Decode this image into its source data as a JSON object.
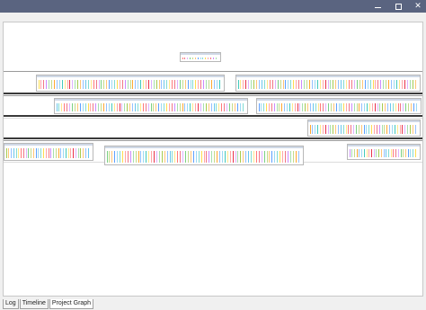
{
  "window": {
    "controls": {
      "minimize_icon": "minimize-icon",
      "maximize_icon": "maximize-icon",
      "close_icon": "close-icon"
    }
  },
  "tabs": [
    {
      "label": "Log",
      "active": false
    },
    {
      "label": "Timeline",
      "active": false
    },
    {
      "label": "Project Graph",
      "active": true
    }
  ],
  "colors": {
    "titlebar": "#5a6480",
    "strip_palette": [
      "#ff6b6b",
      "#6bcb77",
      "#4d96ff",
      "#ffd93d",
      "#c77dff",
      "#ff9f1c",
      "#2ec4b6",
      "#e71d36",
      "#9bc53d",
      "#5bc0eb"
    ]
  }
}
